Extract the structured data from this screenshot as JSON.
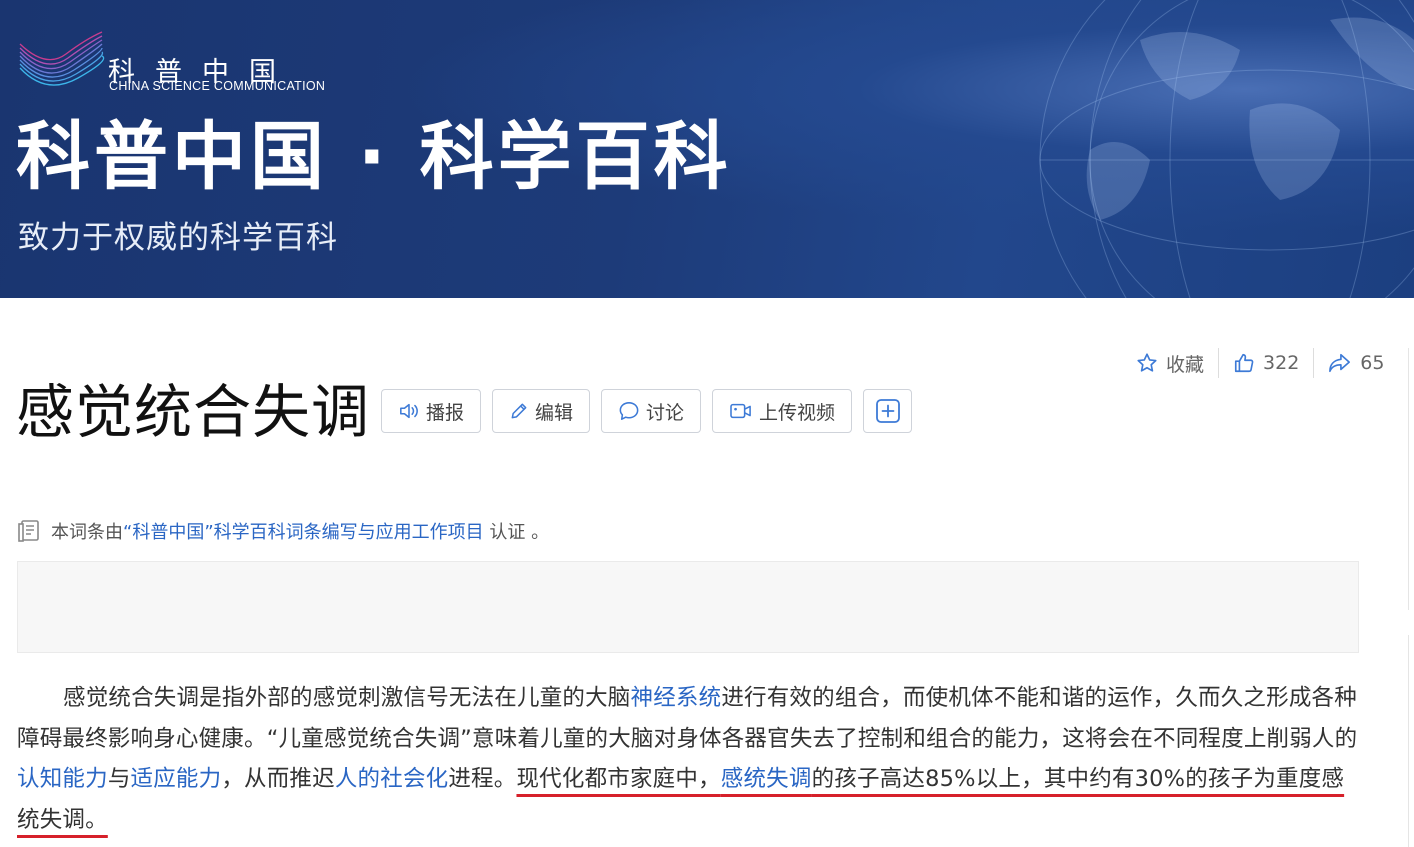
{
  "banner": {
    "logo_cn": "科普中国",
    "logo_en": "CHINA SCIENCE COMMUNICATION",
    "title": "科普中国 · 科学百科",
    "subtitle": "致力于权威的科学百科"
  },
  "stats": {
    "favorite_label": "收藏",
    "likes": "322",
    "shares": "65"
  },
  "entry": {
    "title": "感觉统合失调"
  },
  "toolbar": {
    "broadcast": "播报",
    "edit": "编辑",
    "discuss": "讨论",
    "upload_video": "上传视频"
  },
  "certify": {
    "prefix": "本词条由",
    "org": "“科普中国”科学百科词条编写与应用工作项目",
    "suffix": " 认证 。"
  },
  "paragraph": {
    "t1": "感觉统合失调是指外部的感觉刺激信号无法在儿童的大脑",
    "l1": "神经系统",
    "t2": "进行有效的组合，而使机体不能和谐的运作，久而久之形成各种障碍最终影响身心健康。“儿童感觉统合失调”意味着儿童的大脑对身体各器官失去了控制和组合的能力，这将会在不同程度上削弱人的",
    "l2": "认知能力",
    "t3": "与",
    "l3": "适应能力",
    "t4": "，从而推迟",
    "l4": "人的社会化",
    "t5": "进程。",
    "u1": "现代化都市家庭中，",
    "l5": "感统失调",
    "u2": "的孩子高达85%以上，其中约有30%的孩子为重度感统失调。"
  },
  "colors": {
    "banner_bg": "#1d3b79",
    "link": "#2a66c4",
    "underline": "#d6202a"
  }
}
